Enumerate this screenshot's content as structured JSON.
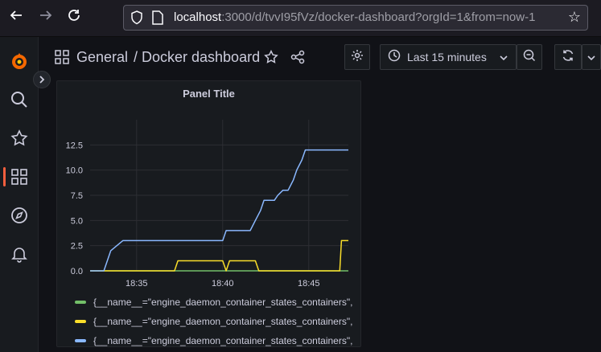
{
  "browser": {
    "url_host": "localhost",
    "url_rest": ":3000/d/tvvI95fVz/docker-dashboard?orgId=1&from=now-1"
  },
  "breadcrumb": {
    "parent": "General",
    "title": "/ Docker dashboard"
  },
  "toolbar": {
    "time_range": "Last 15 minutes"
  },
  "colors": {
    "green": "#73bf69",
    "yellow": "#fade2a",
    "blue": "#8ab8ff",
    "accent": "#f55f3e"
  },
  "panel": {
    "title": "Panel Title"
  },
  "chart_data": {
    "type": "line",
    "title": "Panel Title",
    "xlabel": "",
    "ylabel": "",
    "x_ticks": [
      "18:35",
      "18:40",
      "18:45"
    ],
    "y_ticks": [
      "0.0",
      "2.5",
      "5.0",
      "7.5",
      "10.0",
      "12.5"
    ],
    "ylim": [
      0,
      15
    ],
    "xlim_minutes": [
      32.3,
      47.3
    ],
    "grid": true,
    "legend_position": "bottom",
    "series": [
      {
        "name": "{__name__=\"engine_daemon_container_states_containers\",",
        "color": "#73bf69",
        "x": [
          32.3,
          38.5,
          38.7,
          40.0,
          47.3
        ],
        "y": [
          0,
          0,
          0,
          0,
          0
        ]
      },
      {
        "name": "{__name__=\"engine_daemon_container_states_containers\",",
        "color": "#fade2a",
        "x": [
          32.3,
          37.2,
          37.4,
          40.0,
          40.2,
          40.4,
          41.9,
          42.1,
          46.8,
          46.9,
          47.3
        ],
        "y": [
          0,
          0,
          1,
          1,
          0,
          1,
          1,
          0,
          0,
          3,
          3
        ]
      },
      {
        "name": "{__name__=\"engine_daemon_container_states_containers\",",
        "color": "#8ab8ff",
        "x": [
          32.3,
          33.1,
          33.5,
          34.2,
          38.6,
          40.0,
          40.2,
          41.6,
          41.9,
          42.2,
          42.4,
          43.0,
          43.2,
          43.5,
          43.8,
          44.1,
          44.3,
          44.6,
          44.8,
          47.3
        ],
        "y": [
          0,
          0,
          2,
          3,
          3,
          3,
          4,
          4,
          5,
          6,
          7,
          7,
          7.5,
          8,
          8,
          9,
          10,
          11,
          12,
          12
        ]
      }
    ]
  },
  "legend": {
    "items": [
      {
        "label": "{__name__=\"engine_daemon_container_states_containers\","
      },
      {
        "label": "{__name__=\"engine_daemon_container_states_containers\","
      },
      {
        "label": "{__name__=\"engine_daemon_container_states_containers\","
      }
    ]
  }
}
